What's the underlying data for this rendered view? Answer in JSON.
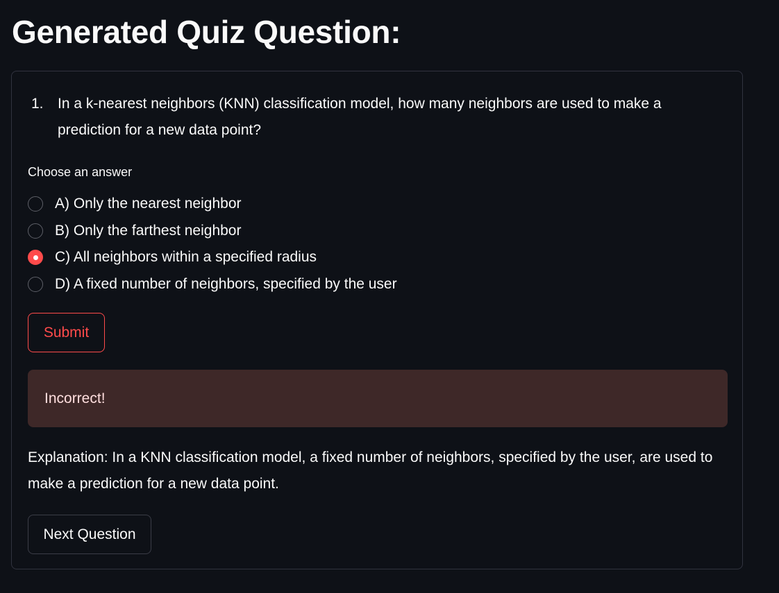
{
  "page": {
    "title": "Generated Quiz Question:"
  },
  "question": {
    "number": "1.",
    "text": "In a k-nearest neighbors (KNN) classification model, how many neighbors are used to make a prediction for a new data point?"
  },
  "answers": {
    "label": "Choose an answer",
    "selected_index": 2,
    "options": [
      {
        "label": "A) Only the nearest neighbor",
        "selected": false
      },
      {
        "label": "B) Only the farthest neighbor",
        "selected": false
      },
      {
        "label": "C) All neighbors within a specified radius",
        "selected": true
      },
      {
        "label": "D) A fixed number of neighbors, specified by the user",
        "selected": false
      }
    ]
  },
  "buttons": {
    "submit_label": "Submit",
    "next_label": "Next Question"
  },
  "result": {
    "message": "Incorrect!"
  },
  "explanation": {
    "text": "Explanation: In a KNN classification model, a fixed number of neighbors, specified by the user, are used to make a prediction for a new data point."
  },
  "colors": {
    "background": "#0e1117",
    "accent": "#ff4b4b",
    "error_background": "#3e2828",
    "text": "#fafafa"
  }
}
